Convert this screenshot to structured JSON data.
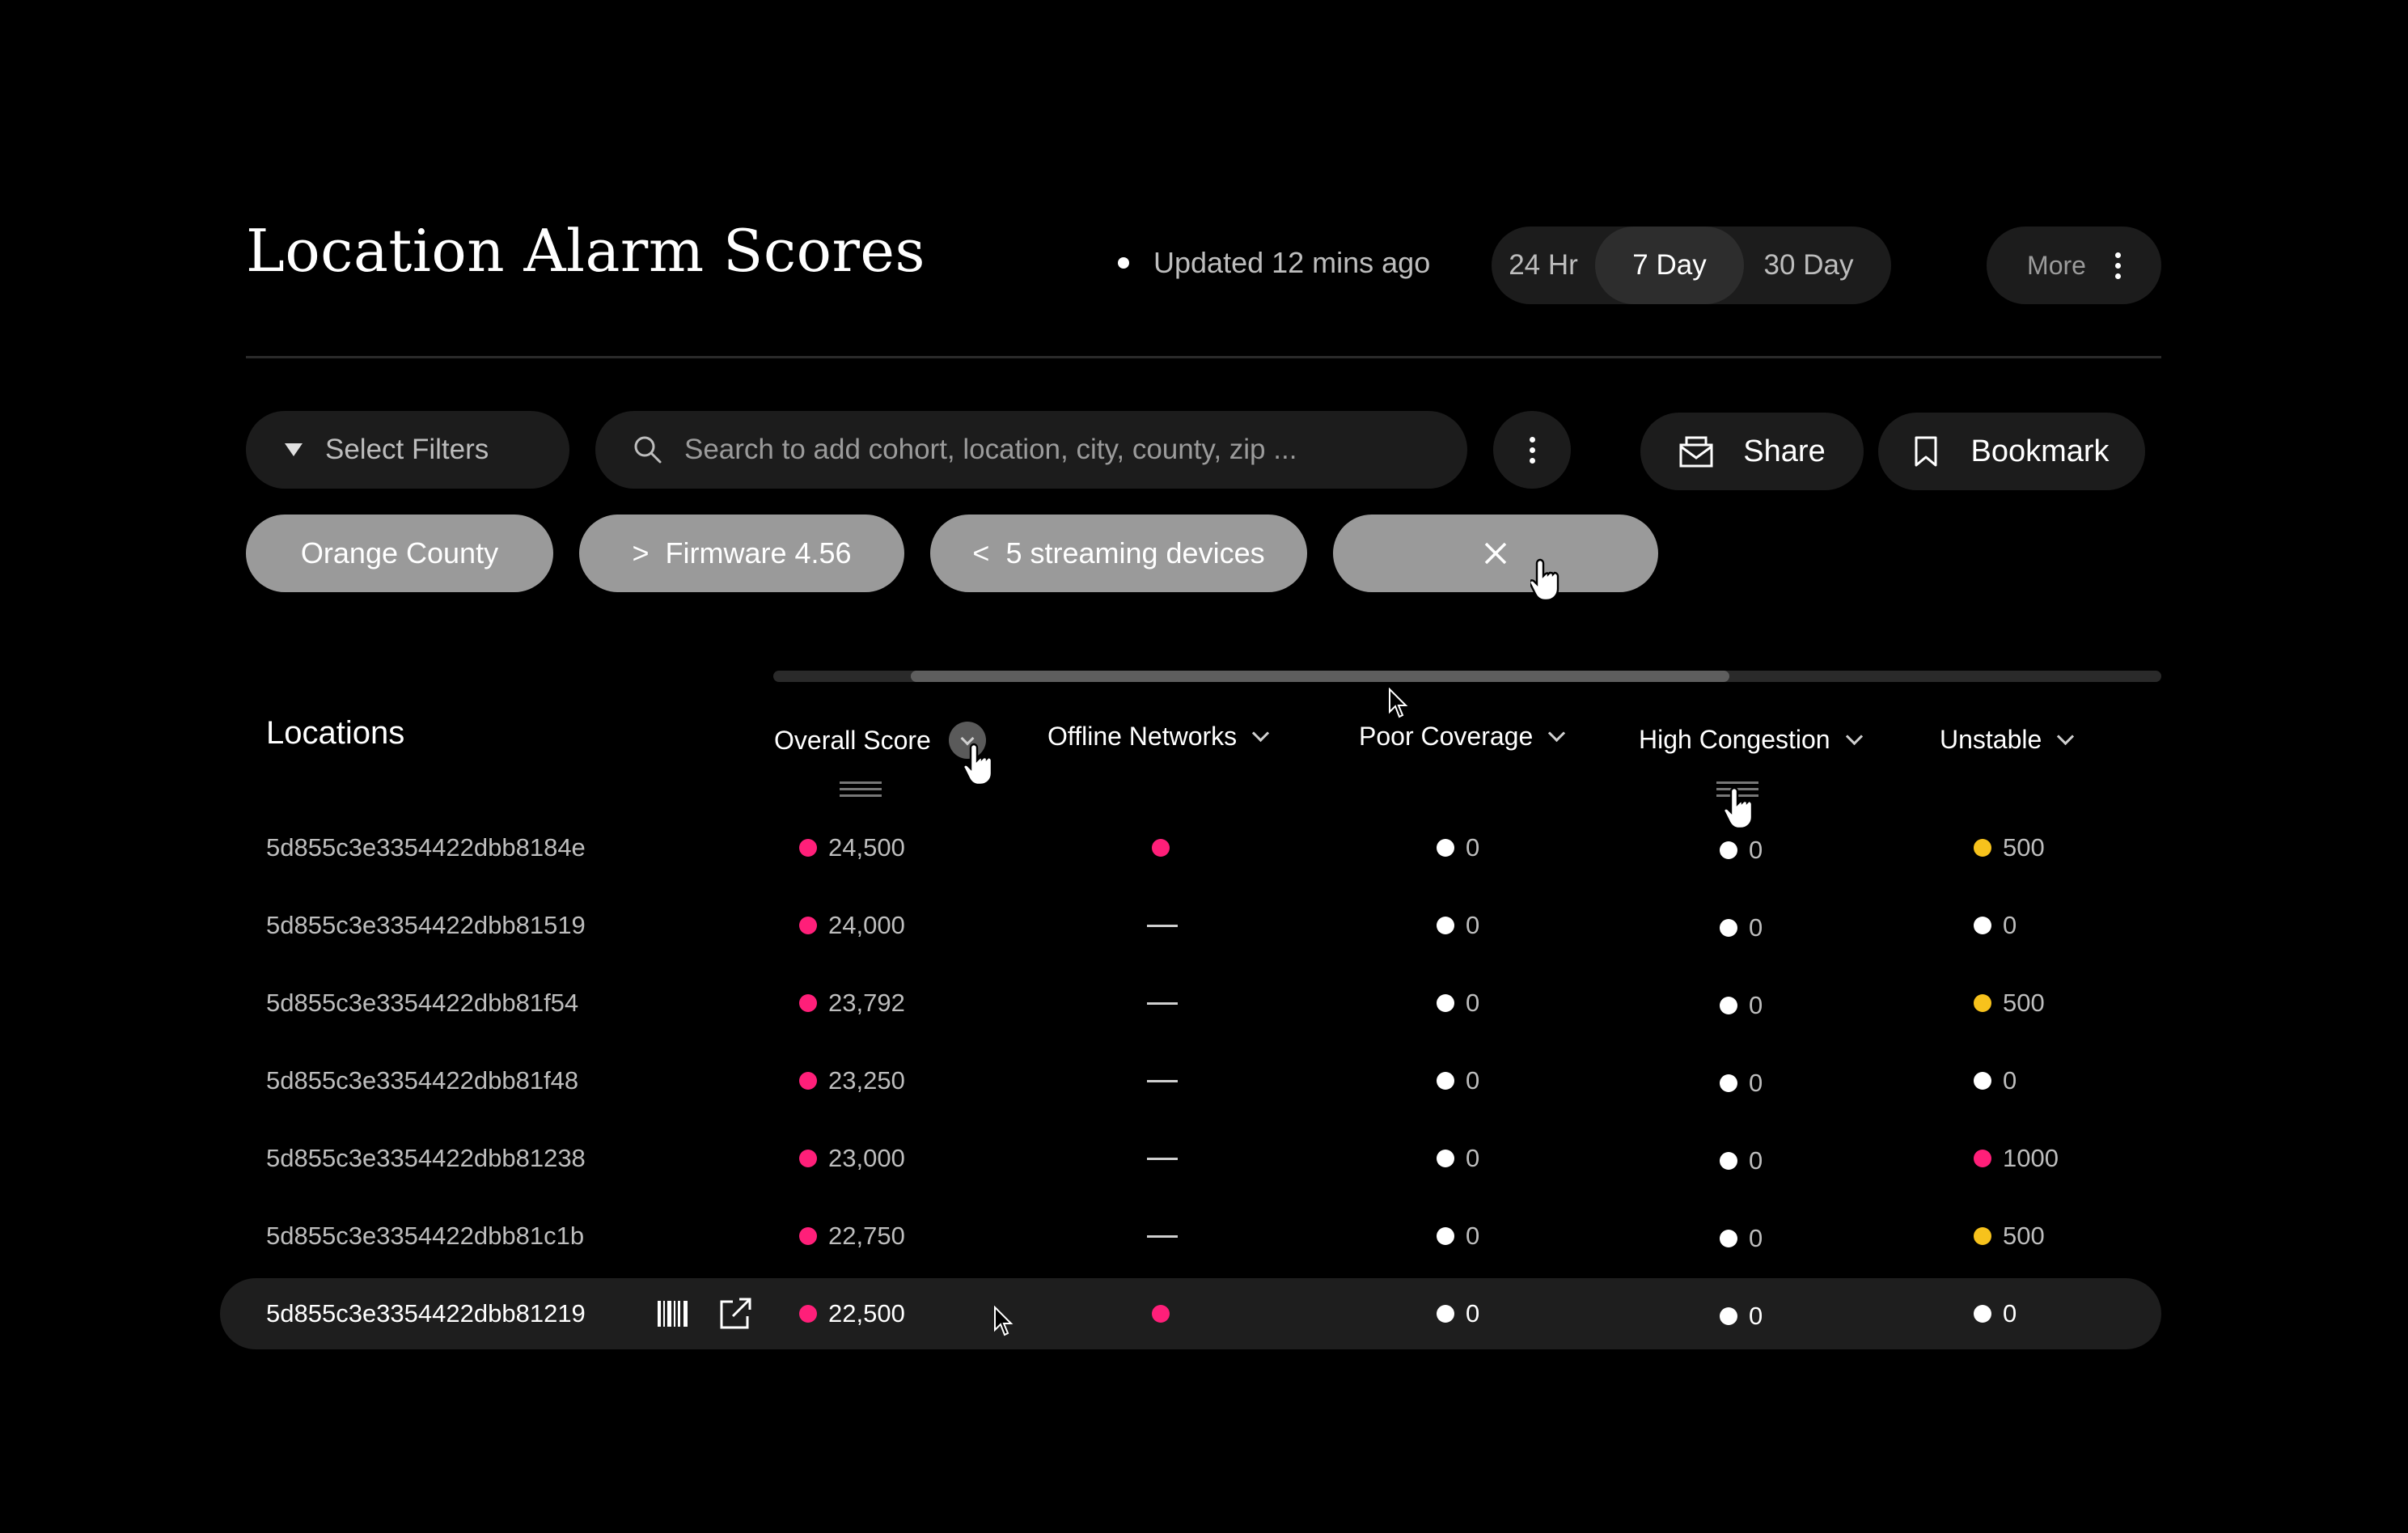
{
  "header": {
    "title": "Location Alarm Scores",
    "updated": "Updated 12 mins ago",
    "time_ranges": [
      "24 Hr",
      "7 Day",
      "30 Day"
    ],
    "active_range": "7 Day",
    "more_label": "More"
  },
  "filters": {
    "select_label": "Select Filters",
    "search_placeholder": "Search to add cohort, location, city, county, zip ...",
    "share_label": "Share",
    "bookmark_label": "Bookmark",
    "chips": [
      {
        "prefix": "",
        "label": "Orange County"
      },
      {
        "prefix": ">",
        "label": "Firmware 4.56"
      },
      {
        "prefix": "<",
        "label": "5 streaming devices"
      }
    ]
  },
  "table": {
    "locations_title": "Locations",
    "columns": [
      "Overall Score",
      "Offline Networks",
      "Poor Coverage",
      "High Congestion",
      "Unstable"
    ],
    "rows": [
      {
        "id": "5d855c3e3354422dbb8184e",
        "overall": "24,500",
        "offline": "dot",
        "poor": "0",
        "congestion": "0",
        "unstable": "500",
        "unstable_color": "yellow"
      },
      {
        "id": "5d855c3e3354422dbb81519",
        "overall": "24,000",
        "offline": "—",
        "poor": "0",
        "congestion": "0",
        "unstable": "0",
        "unstable_color": "white"
      },
      {
        "id": "5d855c3e3354422dbb81f54",
        "overall": "23,792",
        "offline": "—",
        "poor": "0",
        "congestion": "0",
        "unstable": "500",
        "unstable_color": "yellow"
      },
      {
        "id": "5d855c3e3354422dbb81f48",
        "overall": "23,250",
        "offline": "—",
        "poor": "0",
        "congestion": "0",
        "unstable": "0",
        "unstable_color": "white"
      },
      {
        "id": "5d855c3e3354422dbb81238",
        "overall": "23,000",
        "offline": "—",
        "poor": "0",
        "congestion": "0",
        "unstable": "1000",
        "unstable_color": "pink"
      },
      {
        "id": "5d855c3e3354422dbb81c1b",
        "overall": "22,750",
        "offline": "—",
        "poor": "0",
        "congestion": "0",
        "unstable": "500",
        "unstable_color": "yellow"
      },
      {
        "id": "5d855c3e3354422dbb81219",
        "overall": "22,500",
        "offline": "dot",
        "poor": "0",
        "congestion": "0",
        "unstable": "0",
        "unstable_color": "white"
      }
    ]
  },
  "colors": {
    "pink": "#ff1f79",
    "yellow": "#f7c21c",
    "white": "#ffffff",
    "chip": "#9a9a9a"
  },
  "icons": [
    "filter-triangle-icon",
    "search-icon",
    "kebab-icon",
    "share-envelope-icon",
    "bookmark-icon",
    "close-icon",
    "chevron-down-icon",
    "barcode-icon",
    "external-link-icon",
    "drag-handle-icon",
    "hand-cursor-icon",
    "arrow-cursor-icon"
  ]
}
